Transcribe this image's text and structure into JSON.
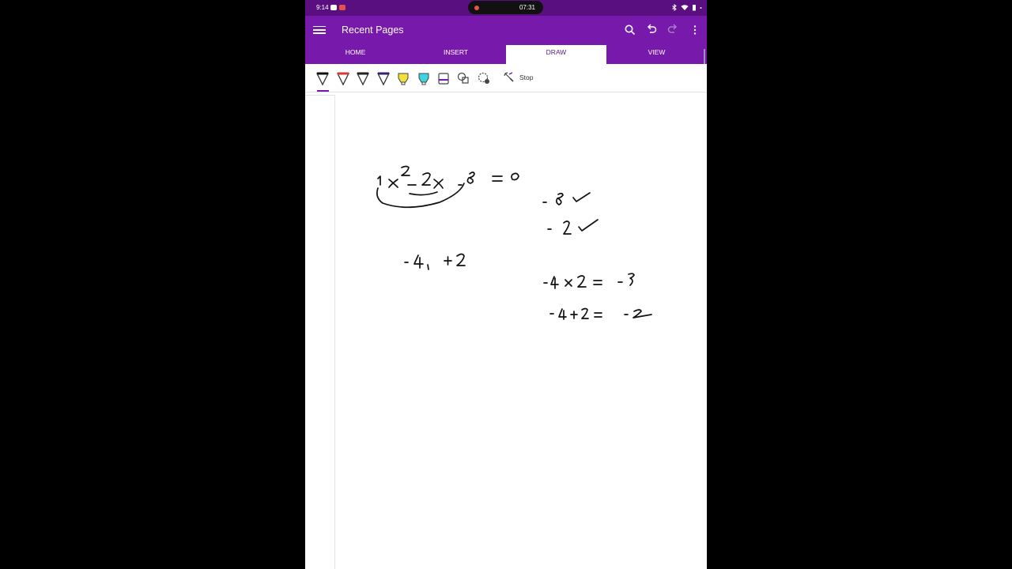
{
  "status_bar": {
    "time": "9:14",
    "recording_time": "07:31"
  },
  "app_bar": {
    "title": "Recent Pages",
    "icons": [
      "menu-icon",
      "search-icon",
      "undo-icon",
      "redo-icon",
      "more-icon"
    ]
  },
  "tabs": [
    {
      "label": "HOME",
      "active": false
    },
    {
      "label": "INSERT",
      "active": false
    },
    {
      "label": "DRAW",
      "active": true
    },
    {
      "label": "VIEW",
      "active": false
    }
  ],
  "toolbar": {
    "tools": [
      "pen-black",
      "pen-red",
      "pen-black-2",
      "pen-purple",
      "highlighter-yellow",
      "highlighter-cyan",
      "eraser",
      "shapes",
      "lasso"
    ],
    "stop_label": "Stop"
  },
  "colors": {
    "accent": "#7719aa",
    "status_bar": "#5a0f80",
    "ink": "#111111"
  }
}
